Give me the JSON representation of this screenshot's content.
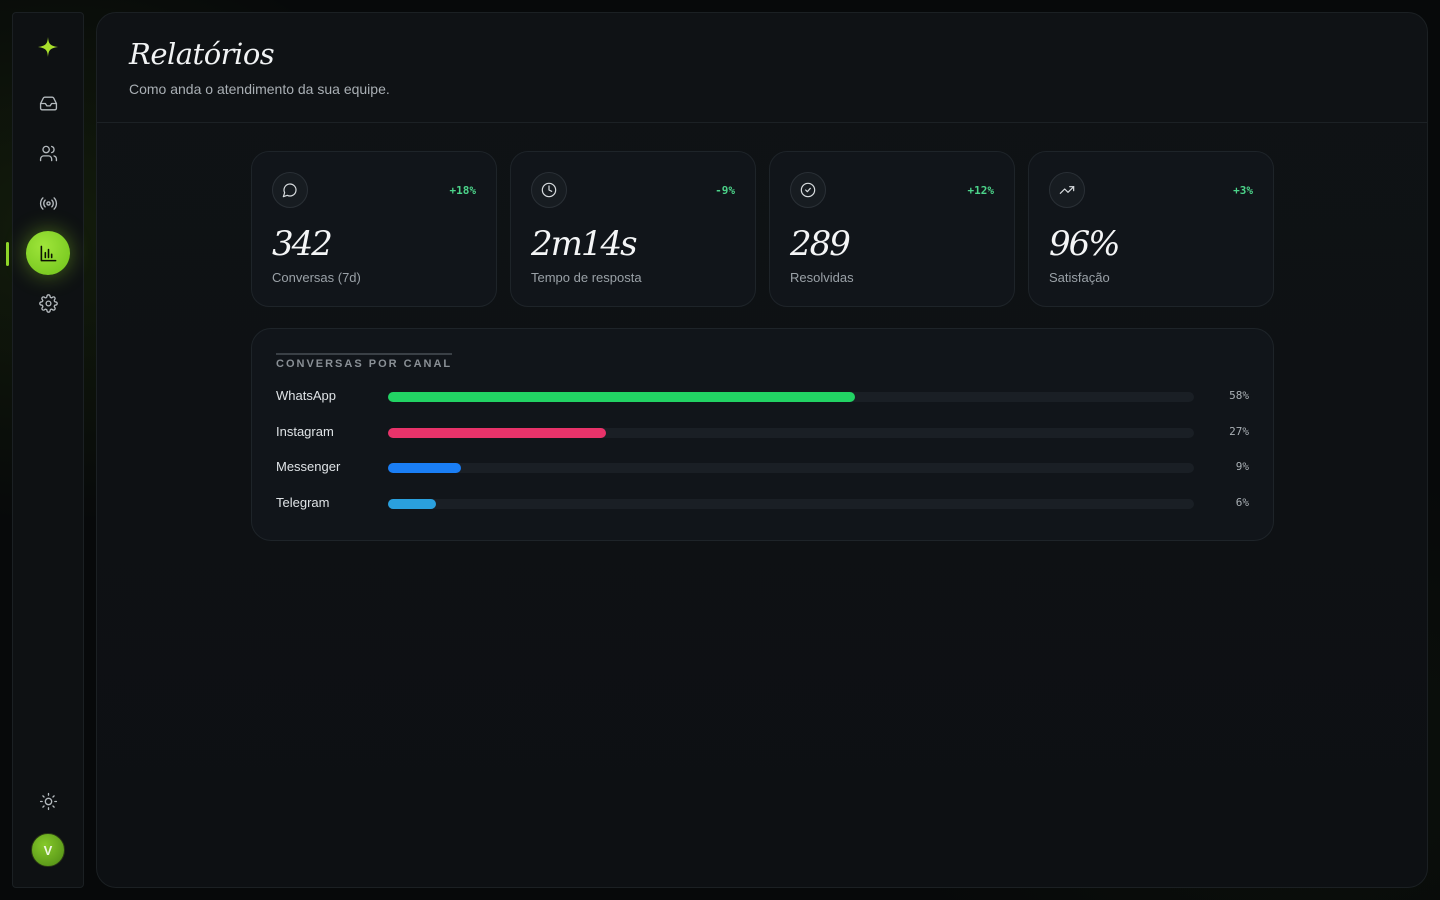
{
  "sidebar": {
    "items": [
      {
        "name": "inbox",
        "icon": "inbox-icon"
      },
      {
        "name": "contacts",
        "icon": "users-icon"
      },
      {
        "name": "broadcast",
        "icon": "broadcast-icon"
      },
      {
        "name": "reports",
        "icon": "bar-chart-icon",
        "active": true
      },
      {
        "name": "settings",
        "icon": "gear-icon"
      }
    ],
    "theme_icon": "sun-icon",
    "avatar_initial": "V",
    "accent": "#8fd62a"
  },
  "header": {
    "title": "Relatórios",
    "subtitle": "Como anda o atendimento da sua equipe."
  },
  "kpis": [
    {
      "icon": "message-circle-icon",
      "delta": "+18%",
      "value": "342",
      "label": "Conversas (7d)"
    },
    {
      "icon": "clock-icon",
      "delta": "-9%",
      "value": "2m14s",
      "label": "Tempo de resposta"
    },
    {
      "icon": "check-circle-icon",
      "delta": "+12%",
      "value": "289",
      "label": "Resolvidas"
    },
    {
      "icon": "trending-up-icon",
      "delta": "+3%",
      "value": "96%",
      "label": "Satisfação"
    }
  ],
  "channels": {
    "title": "CONVERSAS POR CANAL",
    "rows": [
      {
        "name": "WhatsApp",
        "pct_label": "58%",
        "value": 0.58,
        "color": "#22d364"
      },
      {
        "name": "Instagram",
        "pct_label": "27%",
        "value": 0.27,
        "color": "#e8336a"
      },
      {
        "name": "Messenger",
        "pct_label": "9%",
        "value": 0.09,
        "color": "#1a7ef5"
      },
      {
        "name": "Telegram",
        "pct_label": "6%",
        "value": 0.06,
        "color": "#2aa0de"
      }
    ]
  }
}
